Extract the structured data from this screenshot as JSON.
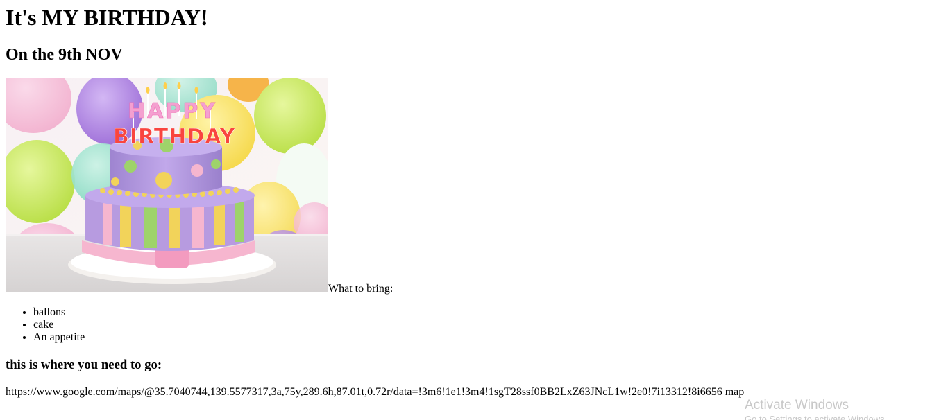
{
  "heading": "It's MY BIRTHDAY!",
  "subheading": "On the 9th NOV",
  "image": {
    "topper_text": [
      "HAPPY",
      "BIRTHDAY"
    ],
    "colors": {
      "frosting_purple": "#b79be0",
      "stripe_yellow": "#f2d35a",
      "stripe_green": "#9ed36a",
      "stripe_pink": "#f6b6cf",
      "board": "#f4f1ee"
    }
  },
  "bring": {
    "label": "What to bring:",
    "items": [
      "ballons",
      "cake",
      "An appetite"
    ]
  },
  "directions": {
    "heading": "this is where you need to go:",
    "url": "https://www.google.com/maps/@35.7040744,139.5577317,3a,75y,289.6h,87.01t,0.72r/data=!3m6!1e1!3m4!1sgT28ssf0BB2LxZ63JNcL1w!2e0!7i13312!8i6656",
    "link_text": "map"
  },
  "watermark": {
    "title": "Activate Windows",
    "subtitle": "Go to Settings to activate Windows."
  }
}
